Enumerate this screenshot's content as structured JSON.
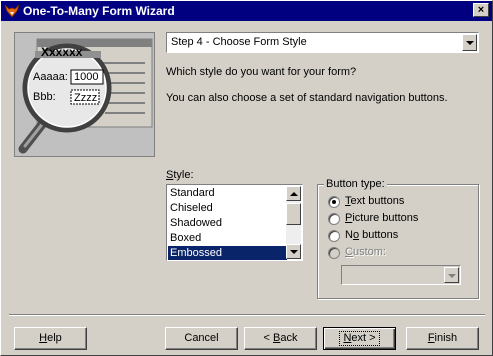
{
  "window": {
    "title": "One-To-Many Form Wizard",
    "close_glyph": "×"
  },
  "preview": {
    "heading": "Xxxxxx",
    "field1_label": "Aaaaa:",
    "field1_value": "1000",
    "field2_label": "Bbb:",
    "field2_value": "Zzzz"
  },
  "step_select": {
    "value": "Step 4 - Choose Form Style"
  },
  "instructions": {
    "line1": "Which style do you want for your form?",
    "line2": "You can also choose a set of standard navigation buttons."
  },
  "style_list": {
    "label_prefix": "S",
    "label_rest": "tyle:",
    "items": [
      "Standard",
      "Chiseled",
      "Shadowed",
      "Boxed",
      "Embossed"
    ],
    "selected": "Embossed"
  },
  "button_type": {
    "label": "Button type:",
    "options": [
      {
        "key": "T",
        "rest": "ext buttons",
        "checked": true,
        "enabled": true
      },
      {
        "key": "P",
        "rest": "icture buttons",
        "checked": false,
        "enabled": true
      },
      {
        "key": "o",
        "pre": "N",
        "rest": " buttons",
        "checked": false,
        "enabled": true
      },
      {
        "key": "C",
        "rest": "ustom:",
        "checked": false,
        "enabled": false
      }
    ],
    "custom_value": ""
  },
  "buttons": {
    "help_key": "H",
    "help_rest": "elp",
    "cancel": "Cancel",
    "back_pre": "< ",
    "back_key": "B",
    "back_rest": "ack",
    "next_key": "N",
    "next_rest": "ext >",
    "finish_key": "F",
    "finish_rest": "inish"
  },
  "colors": {
    "titlebar": "#000080",
    "face": "#d4d0c8",
    "selection": "#0a246a"
  }
}
